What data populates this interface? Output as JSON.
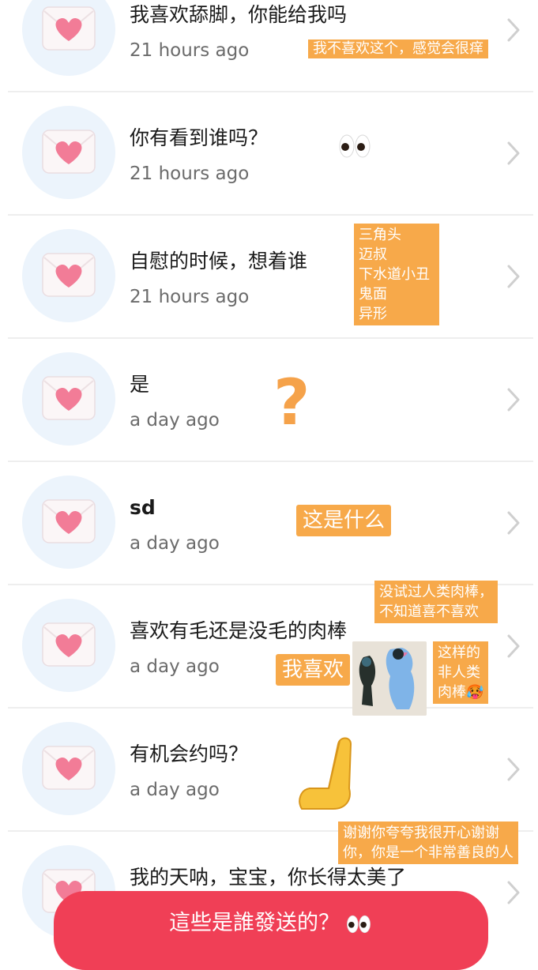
{
  "messages": [
    {
      "text": "我喜欢舔脚，你能给我吗",
      "time": "21 hours ago"
    },
    {
      "text": "你有看到谁吗？",
      "time": "21 hours ago"
    },
    {
      "text": "自慰的时候，想着谁",
      "time": "21 hours ago"
    },
    {
      "text": "是",
      "time": "a day ago"
    },
    {
      "text": "sd",
      "time": "a day ago"
    },
    {
      "text": "喜欢有毛还是没毛的肉棒",
      "time": "a day ago"
    },
    {
      "text": "有机会约吗？",
      "time": "a day ago"
    },
    {
      "text": "我的天呐，宝宝，你长得太美了",
      "time": ""
    }
  ],
  "annotations": {
    "row1": "我不喜欢这个，感觉会很痒",
    "row3_lines": [
      "三角头",
      "迈叔",
      "下水道小丑",
      "鬼面",
      "异形"
    ],
    "row4_mark": "?",
    "row5": "这是什么",
    "row6_top_lines": [
      "没试过人类肉棒，",
      "不知道喜不喜欢"
    ],
    "row6_like": "我喜欢",
    "row6_side_lines": [
      "这样的",
      "非人类",
      "肉棒🥵"
    ],
    "row8_lines": [
      "谢谢你夸夸我很开心谢谢",
      "你，你是一个非常善良的人"
    ]
  },
  "cta": {
    "label": "這些是誰發送的？"
  },
  "colors": {
    "accent": "#f03f56",
    "note": "#f7a94a",
    "avatar_bg": "#ecf4fc",
    "heart": "#f27c97"
  },
  "icons": [
    "love-letter-icon",
    "chevron-right-icon",
    "eyes-emoji-icon",
    "raised-hand-emoji-icon"
  ]
}
